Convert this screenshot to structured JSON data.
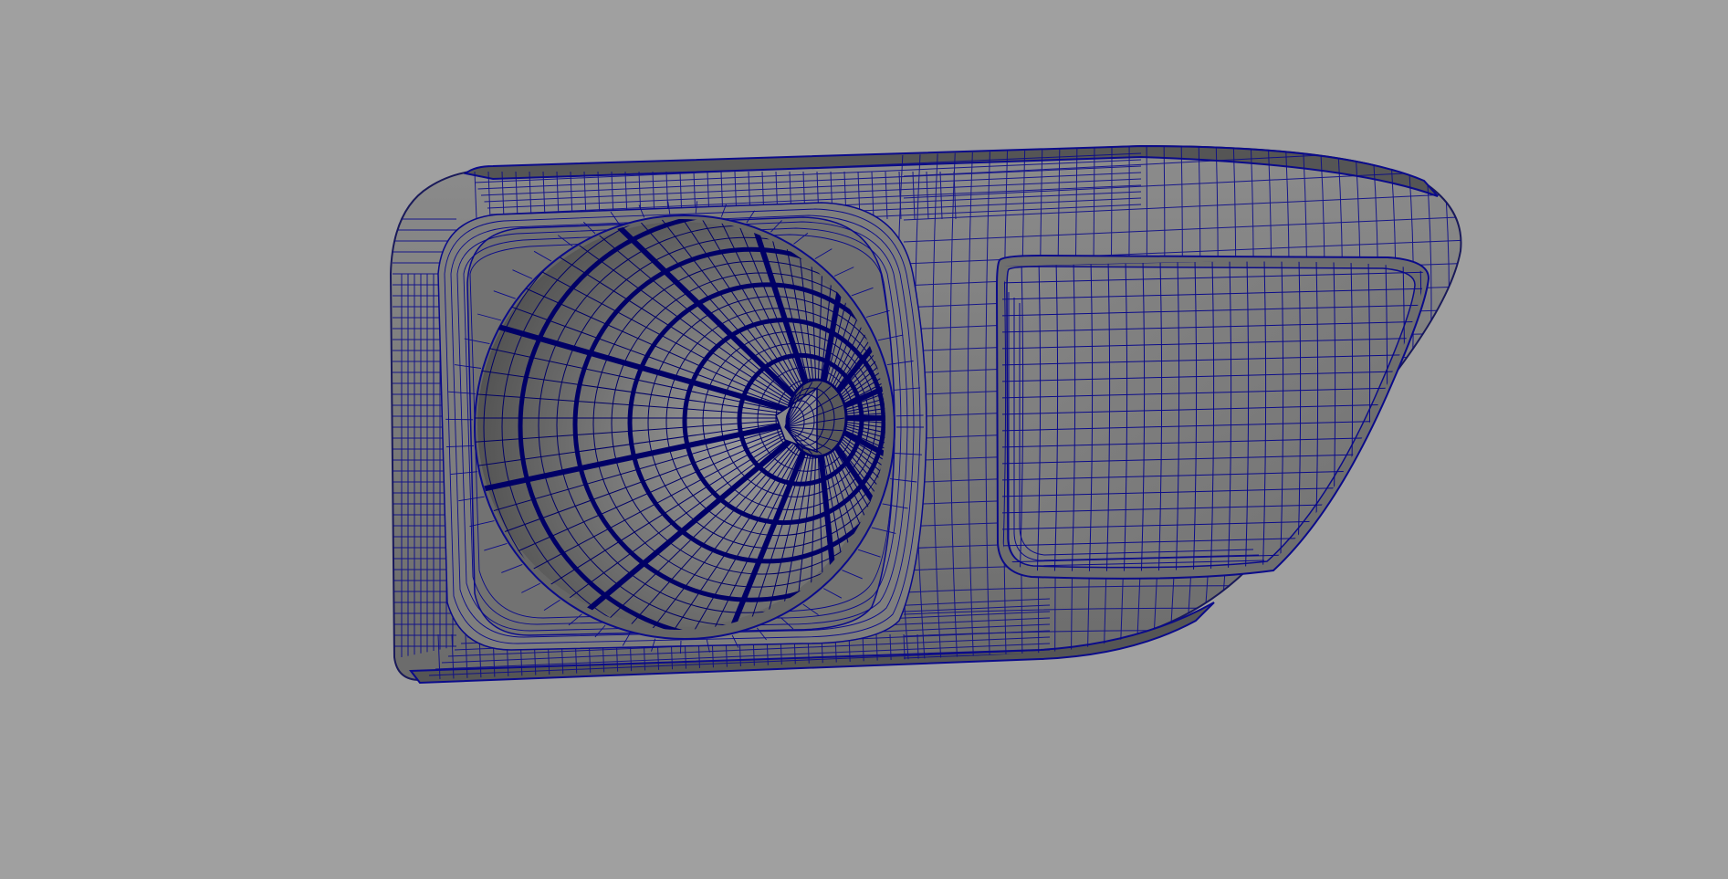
{
  "viewport": {
    "background_color": "#a0a0a0",
    "mode": "wireframe-on-shaded"
  },
  "model": {
    "subject": "headlamp-housing",
    "shade_color": "#7a7a7a",
    "shade_light_color": "#8e8e8e",
    "shade_dark_color": "#5a5a5a",
    "wire_color": "#0b0b8a",
    "wire_dense_color": "#000066"
  }
}
